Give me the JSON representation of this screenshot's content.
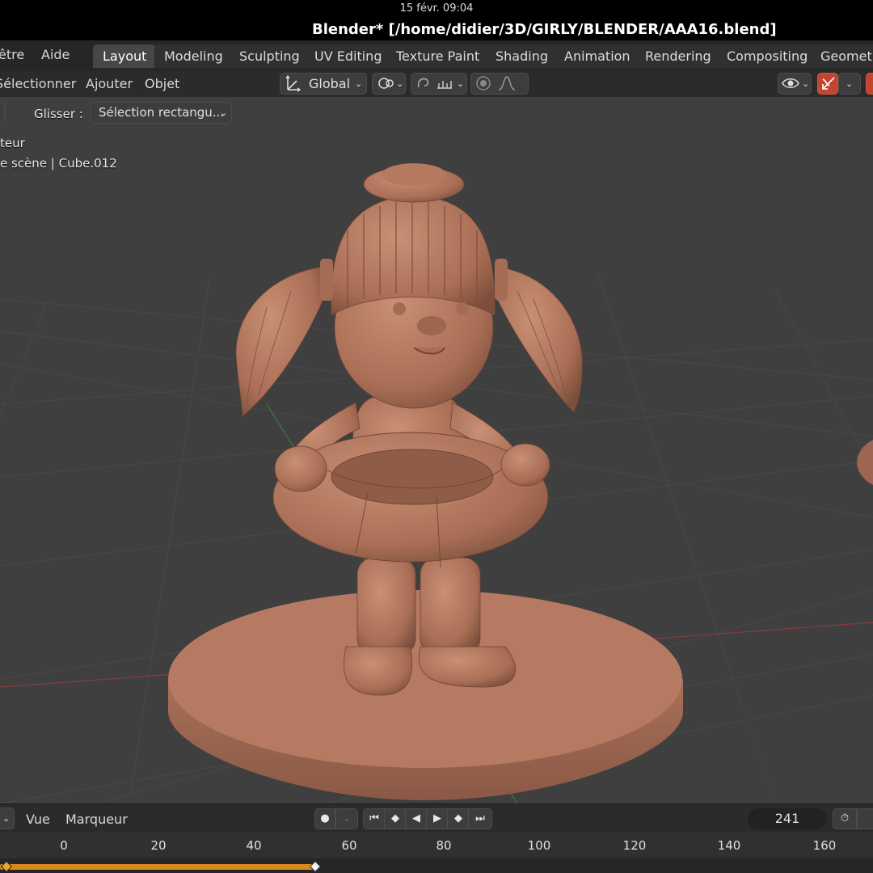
{
  "system": {
    "clock": "15 févr.  09:04"
  },
  "window": {
    "title": "Blender* [/home/didier/3D/GIRLY/BLENDER/AAA16.blend]"
  },
  "menubar": {
    "items": [
      "être",
      "Aide"
    ]
  },
  "workspaces": {
    "active": "Layout",
    "tabs": [
      "Layout",
      "Modeling",
      "Sculpting",
      "UV Editing",
      "Texture Paint",
      "Shading",
      "Animation",
      "Rendering",
      "Compositing",
      "Geometry"
    ]
  },
  "viewport_header": {
    "menus": [
      "Sélectionner",
      "Ajouter",
      "Objet"
    ],
    "orientation": "Global"
  },
  "tool_settings": {
    "drag_label": "Glisser :",
    "drag_value": "Sélection rectangu..."
  },
  "viewport_overlay": {
    "view_name": "teur",
    "scene_info": "e scène | Cube.012"
  },
  "timeline": {
    "menus": [
      "Vue",
      "Marqueur"
    ],
    "current_frame": "241",
    "ticks": [
      "0",
      "20",
      "40",
      "60",
      "80",
      "100",
      "120",
      "140",
      "160"
    ]
  },
  "colors": {
    "accent": "#4772b3",
    "keyframe": "#d98a1f",
    "model": "#b77c63",
    "viewport_bg": "#3f3f3f",
    "gizmo_red": "#c4452f"
  },
  "icons": [
    "transform-icon",
    "snap-icon",
    "proportional-icon",
    "visibility-icon",
    "gizmo-icon",
    "record-icon",
    "stopwatch-icon"
  ]
}
